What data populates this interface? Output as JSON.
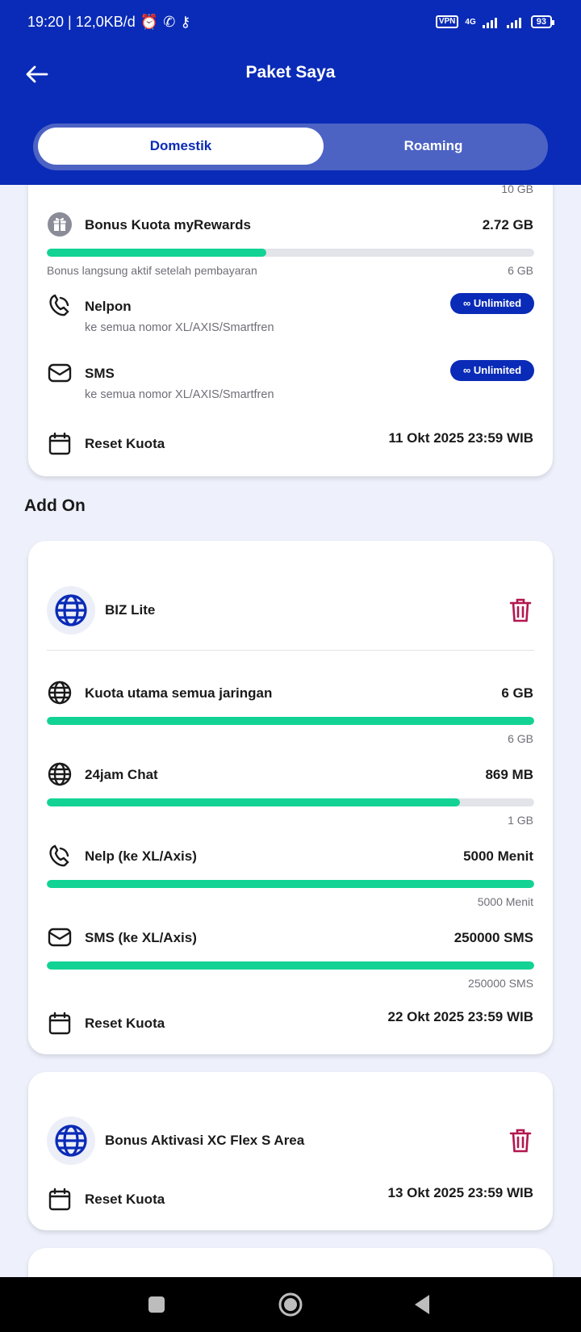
{
  "status_bar": {
    "left_text": "19:20 | 12,0KB/d",
    "vpn": "VPN",
    "network": "4G",
    "battery": "93"
  },
  "header": {
    "title": "Paket Saya"
  },
  "tabs": [
    {
      "label": "Domestik",
      "active": true
    },
    {
      "label": "Roaming",
      "active": false
    }
  ],
  "main_card": {
    "top_cap": "10 GB",
    "bonus": {
      "label": "Bonus Kuota myRewards",
      "value": "2.72 GB",
      "progress": 0.45,
      "note": "Bonus langsung aktif setelah pembayaran",
      "cap": "6 GB"
    },
    "nelpon": {
      "label": "Nelpon",
      "sub": "ke semua nomor XL/AXIS/Smartfren",
      "badge": "∞ Unlimited"
    },
    "sms": {
      "label": "SMS",
      "sub": "ke semua nomor XL/AXIS/Smartfren",
      "badge": "∞ Unlimited"
    },
    "reset": {
      "label": "Reset Kuota",
      "value": "11 Okt 2025 23:59 WIB"
    }
  },
  "addon_title": "Add On",
  "biz_card": {
    "name": "BIZ Lite",
    "items": [
      {
        "label": "Kuota utama semua jaringan",
        "value": "6 GB",
        "progress": 1.0,
        "cap": "6 GB"
      },
      {
        "label": "24jam Chat",
        "value": "869 MB",
        "progress": 0.848,
        "cap": "1 GB"
      },
      {
        "label": "Nelp (ke XL/Axis)",
        "value": "5000 Menit",
        "progress": 1.0,
        "cap": "5000 Menit"
      },
      {
        "label": "SMS (ke XL/Axis)",
        "value": "250000 SMS",
        "progress": 1.0,
        "cap": "250000 SMS"
      }
    ],
    "reset": {
      "label": "Reset Kuota",
      "value": "22 Okt 2025 23:59 WIB"
    }
  },
  "bonus_card": {
    "name": "Bonus Aktivasi XC Flex S Area",
    "reset": {
      "label": "Reset Kuota",
      "value": "13 Okt 2025 23:59 WIB"
    }
  },
  "colors": {
    "brand": "#0a2bb7",
    "progress": "#12d394",
    "trash": "#b3164f"
  }
}
